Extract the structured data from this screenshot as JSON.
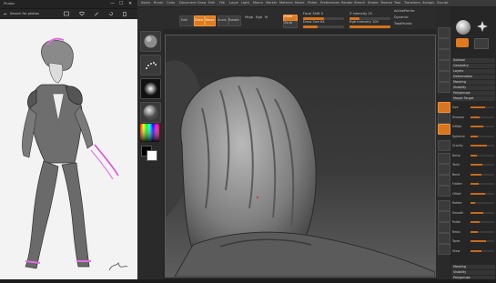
{
  "photos": {
    "app_title": "Photos",
    "breadcrumb": "Search for photos",
    "controls": [
      "—",
      "☐",
      "✕"
    ]
  },
  "zbrush": {
    "menu": [
      "Alpha",
      "Brush",
      "Color",
      "Document",
      "Draw",
      "Edit",
      "File",
      "Layer",
      "Light",
      "Macro",
      "Marker",
      "Material",
      "Movie",
      "Picker",
      "Preferences",
      "Render",
      "Stencil",
      "Stroke",
      "Texture",
      "Tool",
      "Transform",
      "Zplugin",
      "Zscript"
    ],
    "top_labels": {
      "edit": "Edit",
      "draw": "Draw",
      "move": "Move",
      "scale": "Scale",
      "rotate": "Rotate",
      "mrgb": "Mrgb",
      "rgb": "Rgb",
      "m": "M",
      "zadd": "Zadd",
      "zsub": "Zsub",
      "zcut": "Zcut",
      "focal_shift": "Focal Shift 0",
      "draw_size": "Draw Size 64",
      "z_intensity": "Z Intensity 25",
      "rgb_intensity": "Rgb Intensity 100",
      "dynamic": "Dynamic",
      "active_points": "ActivePoints:",
      "total_points": "TotalPoints:"
    },
    "colors": {
      "accent": "#e07b1f",
      "viewport_bg": "#3a3a3a"
    },
    "panel": {
      "sections": [
        "Subtool",
        "Geometry",
        "Layers",
        "Deformation",
        "Masking",
        "Visibility",
        "Polygroups",
        "Morph Target"
      ],
      "sliders": [
        {
          "name": "Size",
          "value": 0.62
        },
        {
          "name": "Sharpen",
          "value": 0.4
        },
        {
          "name": "Inflate",
          "value": 0.55
        },
        {
          "name": "Spherize",
          "value": 0.3
        },
        {
          "name": "Gravity",
          "value": 0.7
        },
        {
          "name": "Noise",
          "value": 0.25
        },
        {
          "name": "Twist",
          "value": 0.5
        },
        {
          "name": "Bend",
          "value": 0.45
        },
        {
          "name": "Flatten",
          "value": 0.35
        },
        {
          "name": "Offset",
          "value": 0.6
        },
        {
          "name": "Rotate",
          "value": 0.2
        },
        {
          "name": "Smooth",
          "value": 0.55
        },
        {
          "name": "Polish",
          "value": 0.4
        },
        {
          "name": "Relax",
          "value": 0.3
        },
        {
          "name": "Taper",
          "value": 0.65
        },
        {
          "name": "Skew",
          "value": 0.45
        }
      ],
      "bottom": [
        "Masking",
        "Visibility",
        "Polygroups"
      ]
    }
  }
}
